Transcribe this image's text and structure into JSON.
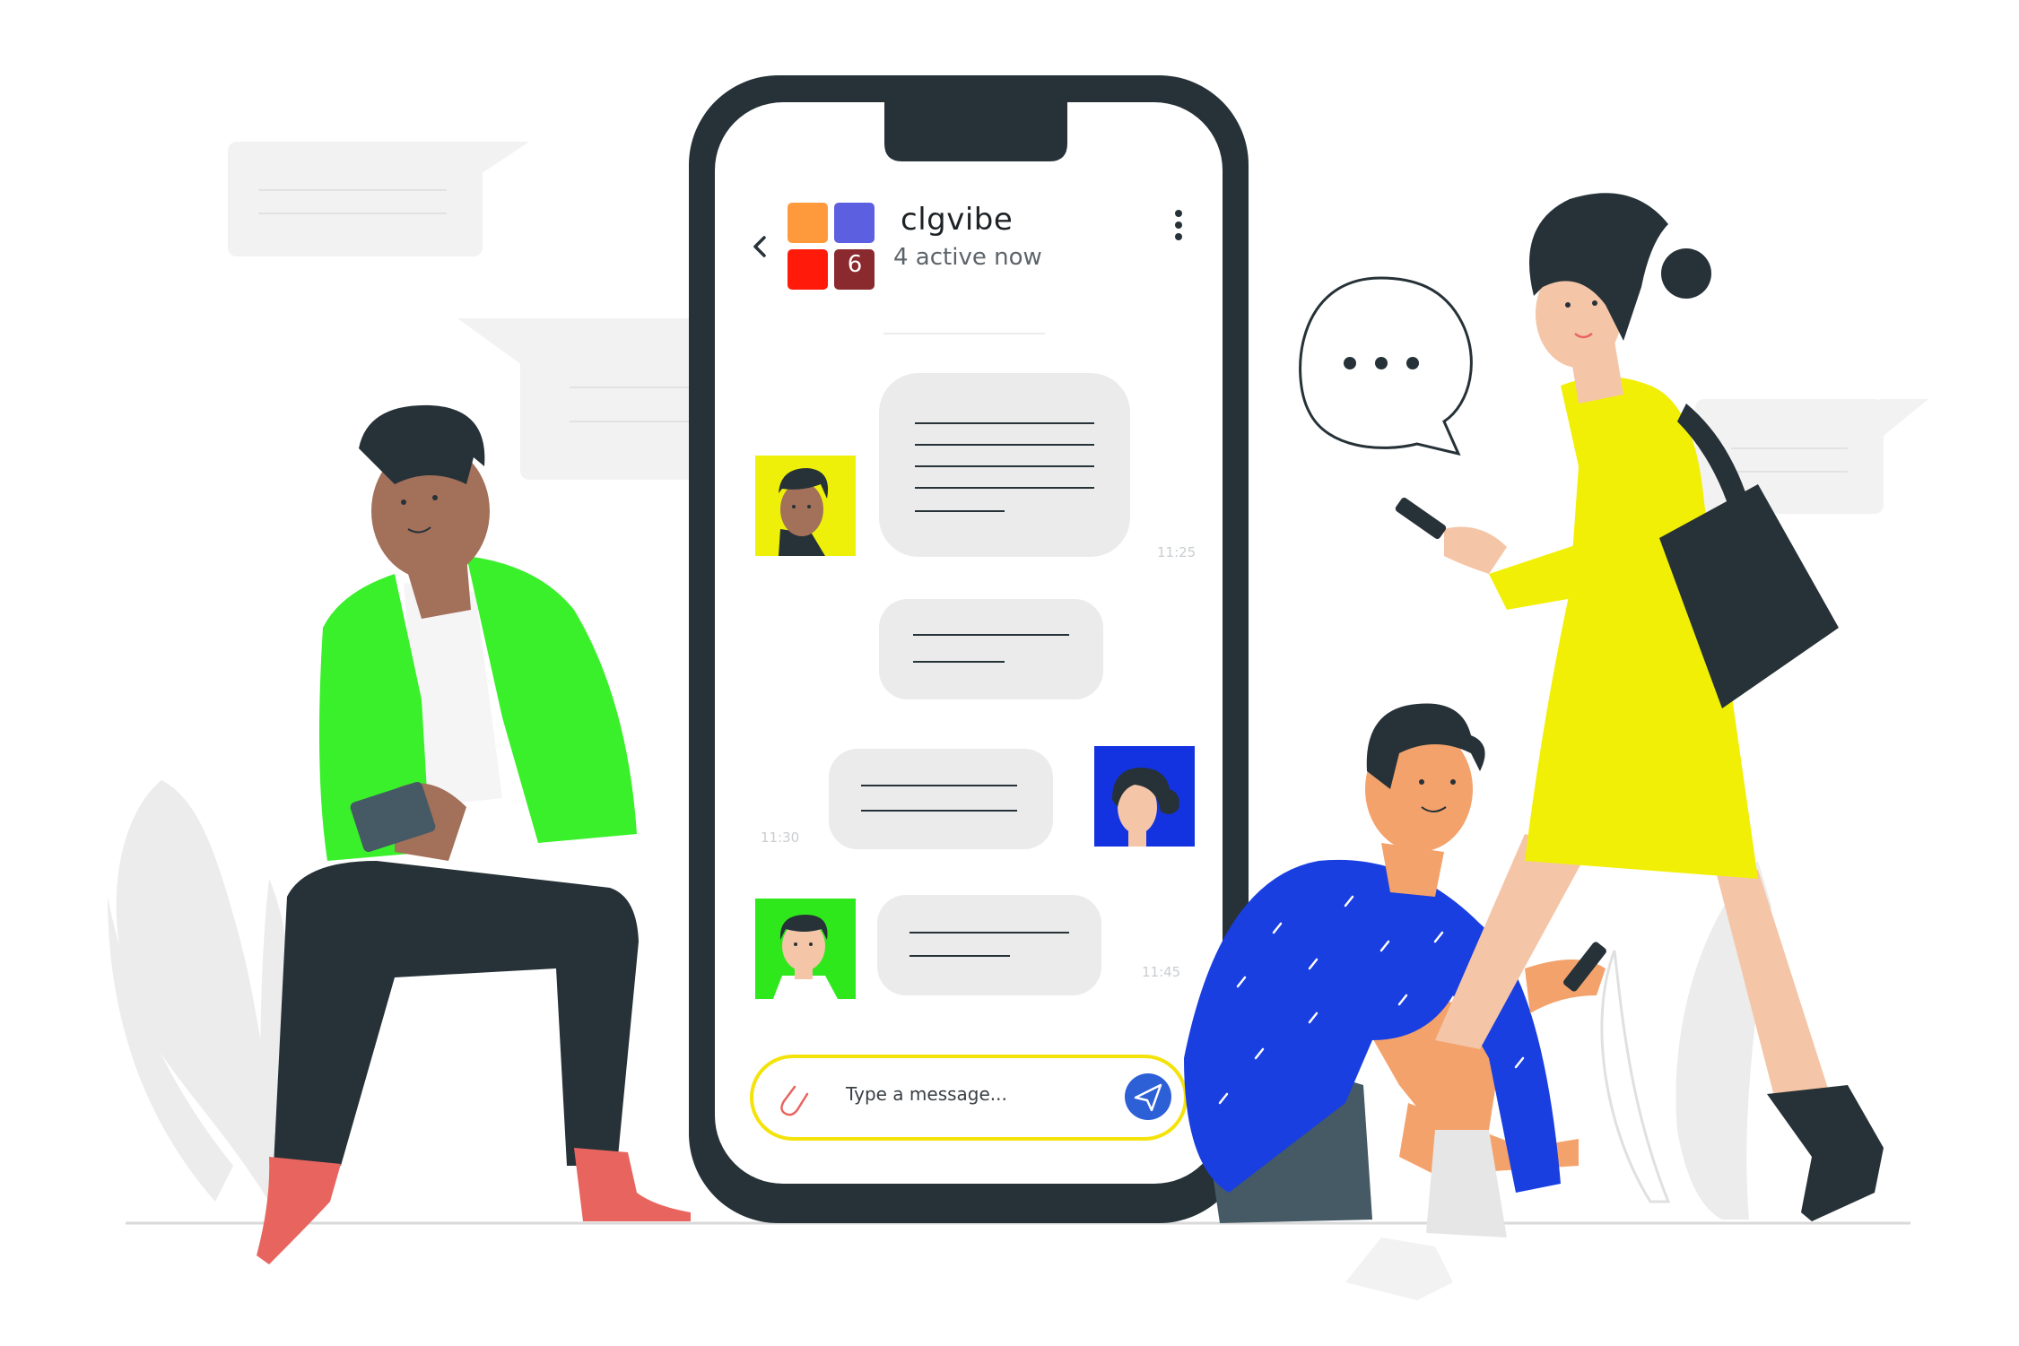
{
  "chat": {
    "group_name": "clgvibe",
    "status": "4 active now",
    "avatar_badge_count": "6",
    "avatar_tile_colors": [
      "#ff9a3c",
      "#5b5fe0",
      "#ff1a0a",
      "#8a2a2e"
    ],
    "menu_icon": "more-vertical-icon",
    "back_icon": "chevron-left-icon"
  },
  "messages": [
    {
      "direction": "received",
      "avatar_bg": "#eef00a",
      "time": "11:25"
    },
    {
      "direction": "received",
      "avatar_bg": null,
      "time": ""
    },
    {
      "direction": "sent",
      "avatar_bg": "#1433e0",
      "time": "11:30"
    },
    {
      "direction": "received",
      "avatar_bg": "#2fe81c",
      "time": "11:45"
    }
  ],
  "composer": {
    "placeholder": "Type a message...",
    "attach_icon": "paperclip-icon",
    "send_icon": "send-icon",
    "border_color": "#f4e30a",
    "send_button_color": "#2d5fd6"
  },
  "illustration": {
    "speech_bubble_icon": "typing-dots-icon",
    "people_colors": {
      "left_man_jacket": "#39f02a",
      "sitting_man_sweater": "#1a3fe0",
      "woman_dress": "#f2ef06"
    }
  }
}
